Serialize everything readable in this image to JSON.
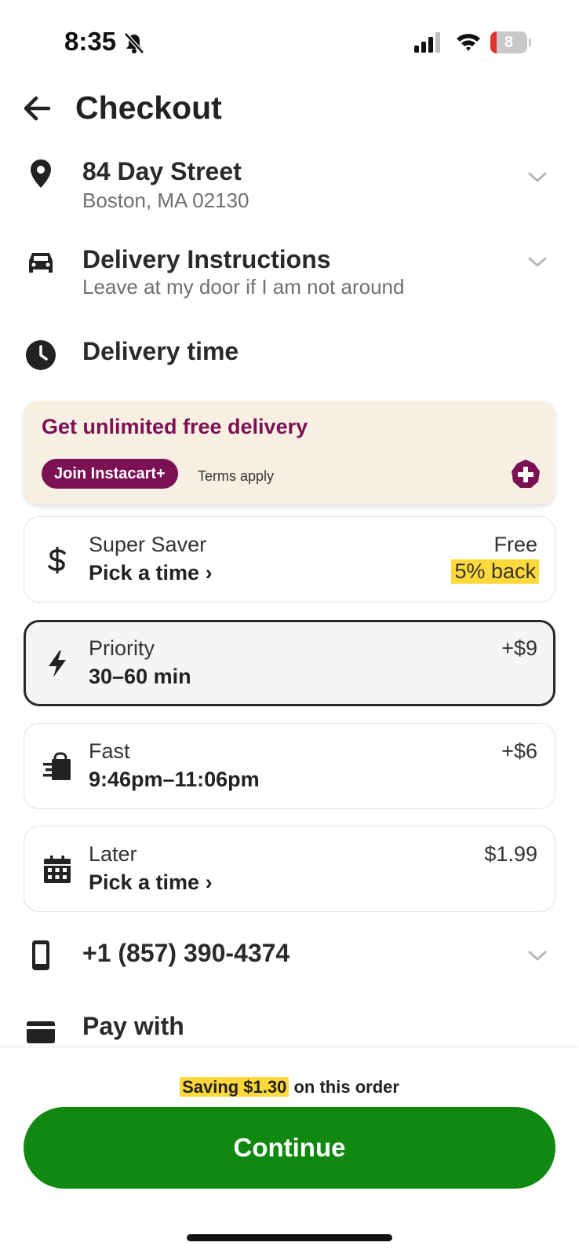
{
  "status_bar": {
    "time": "8:35",
    "battery": "8"
  },
  "header": {
    "title": "Checkout"
  },
  "address": {
    "line1": "84 Day Street",
    "line2": "Boston, MA 02130"
  },
  "delivery_instructions": {
    "title": "Delivery Instructions",
    "subtitle": "Leave at my door if I am not around"
  },
  "delivery_time": {
    "title": "Delivery time"
  },
  "promo": {
    "title": "Get unlimited free delivery",
    "button": "Join Instacart+",
    "terms": "Terms apply"
  },
  "options": [
    {
      "name": "Super Saver",
      "detail": "Pick a time ›",
      "price": "Free",
      "badge": "5% back",
      "icon": "dollar-icon",
      "selected": false
    },
    {
      "name": "Priority",
      "detail": "30–60 min",
      "price": "+$9",
      "icon": "lightning-icon",
      "selected": true
    },
    {
      "name": "Fast",
      "detail": "9:46pm–11:06pm",
      "price": "+$6",
      "icon": "fast-bag-icon",
      "selected": false
    },
    {
      "name": "Later",
      "detail": "Pick a time ›",
      "price": "$1.99",
      "icon": "calendar-icon",
      "selected": false
    }
  ],
  "phone": {
    "number": "+1 (857) 390-4374"
  },
  "pay_with": {
    "title": "Pay with"
  },
  "bottom": {
    "saving_highlight": "Saving $1.30",
    "saving_rest": " on this order",
    "continue": "Continue"
  },
  "colors": {
    "brand_purple": "#7b1053",
    "continue_green": "#108910",
    "highlight_yellow": "#ffd93b",
    "promo_bg": "#f8efe3"
  }
}
